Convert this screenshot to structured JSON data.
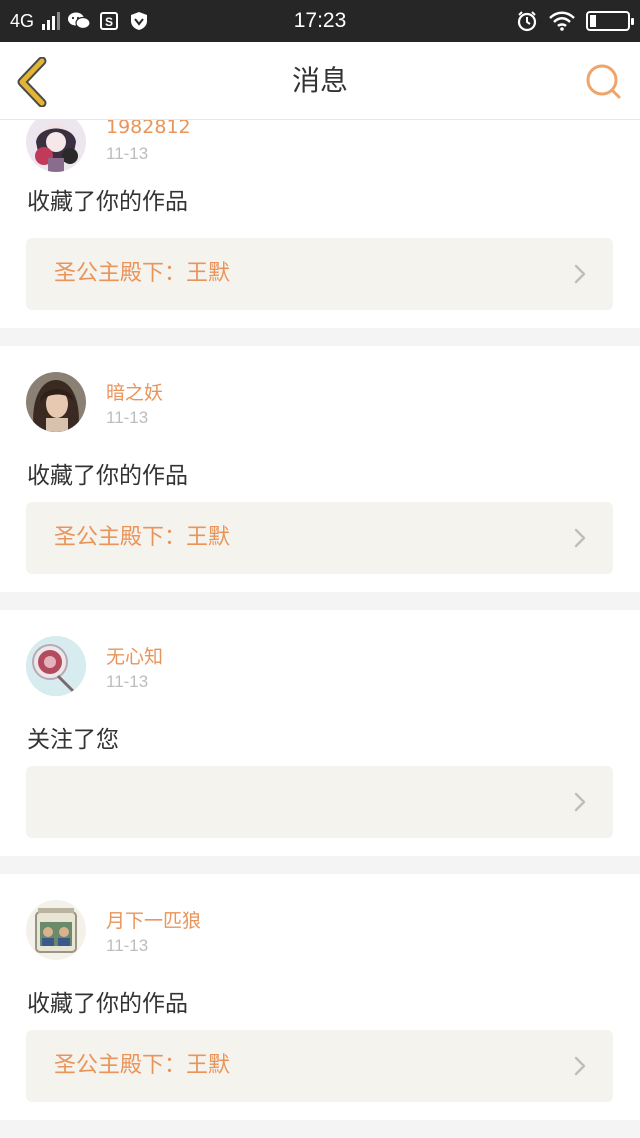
{
  "status_bar": {
    "network": "4G",
    "time": "17:23",
    "icons": [
      "signal-icon",
      "wechat-icon",
      "s-app-icon",
      "shield-icon",
      "alarm-icon",
      "wifi-icon",
      "battery-icon"
    ]
  },
  "header": {
    "title": "消息",
    "back_icon": "chevron-left-icon",
    "search_icon": "search-icon"
  },
  "colors": {
    "accent": "#e9945a",
    "back": "#e2b634",
    "work_bg": "#f4f3ee",
    "page_bg": "#f4f4f4"
  },
  "messages": [
    {
      "username": "1982812",
      "date": "11-13",
      "action": "收藏了你的作品",
      "work_title": "圣公主殿下：王默"
    },
    {
      "username": "暗之妖",
      "date": "11-13",
      "action": "收藏了你的作品",
      "work_title": "圣公主殿下：王默"
    },
    {
      "username": "无心知",
      "date": "11-13",
      "action": "关注了您",
      "work_title": ""
    },
    {
      "username": "月下一匹狼",
      "date": "11-13",
      "action": "收藏了你的作品",
      "work_title": "圣公主殿下：王默"
    }
  ]
}
